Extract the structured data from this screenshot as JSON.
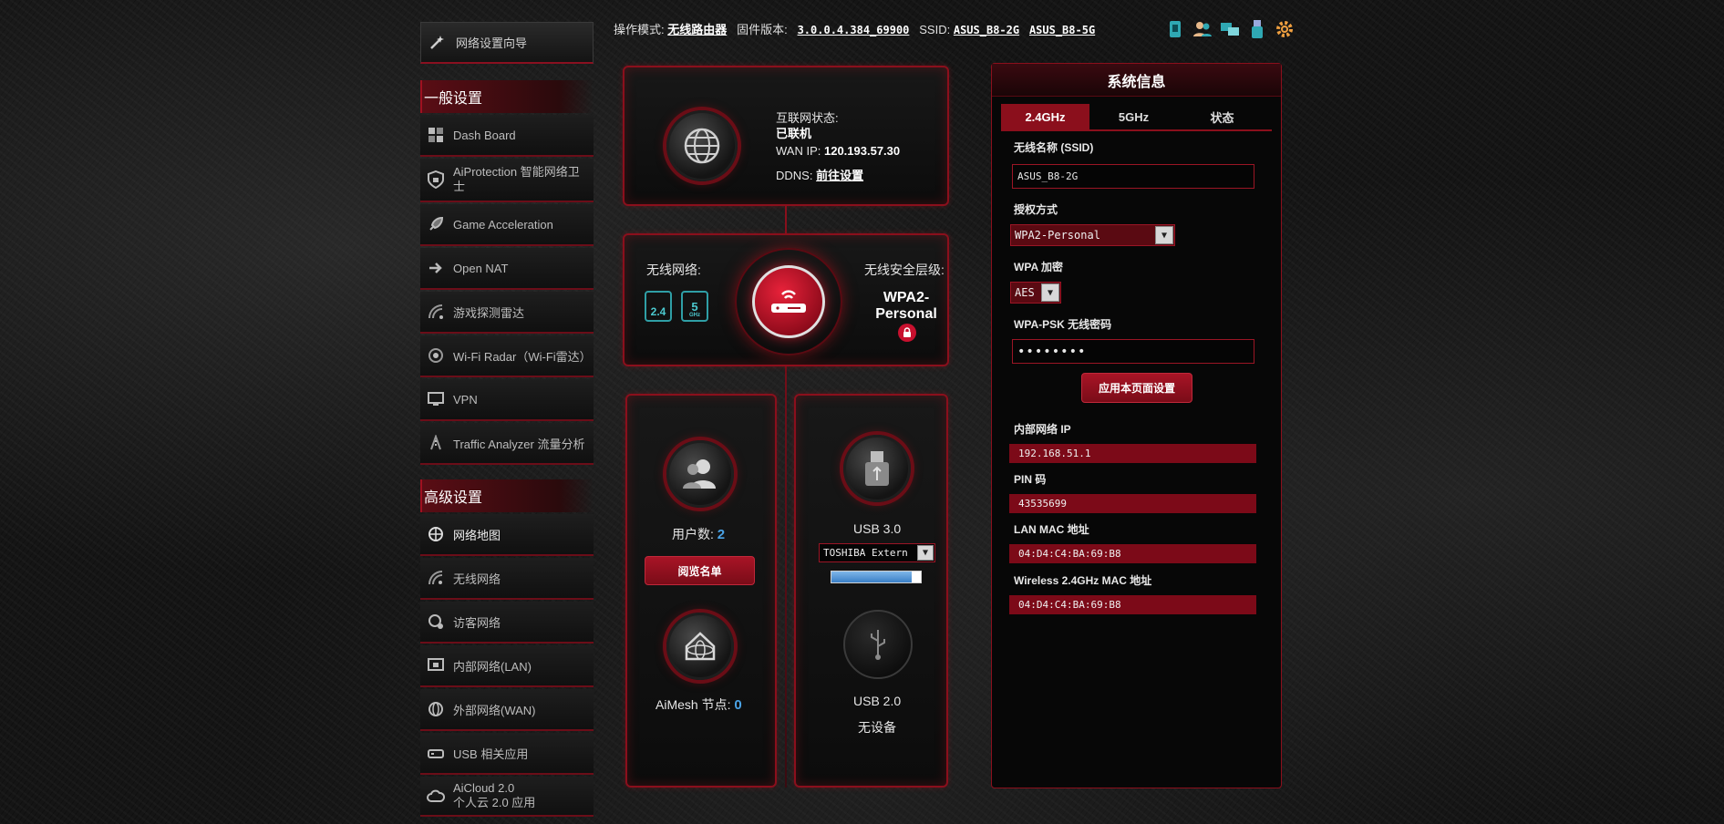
{
  "topbar": {
    "mode_label": "操作模式:",
    "mode_value": "无线路由器",
    "firmware_label": "固件版本:",
    "firmware_value": "3.0.0.4.384_69900",
    "ssid_label": "SSID:",
    "ssid_24": "ASUS_B8-2G",
    "ssid_5": "ASUS_B8-5G"
  },
  "sidebar": {
    "wizard_label": "网络设置向导",
    "general_header": "一般设置",
    "general_items": [
      {
        "label": "Dash Board",
        "icon": "dashboard-icon"
      },
      {
        "label": "AiProtection 智能网络卫士",
        "icon": "shield-icon"
      },
      {
        "label": "Game Acceleration",
        "icon": "rocket-icon"
      },
      {
        "label": "Open NAT",
        "icon": "arrow-icon"
      },
      {
        "label": "游戏探测雷达",
        "icon": "radar-icon"
      },
      {
        "label": "Wi-Fi Radar（Wi-Fi雷达）",
        "icon": "wifi-radar-icon"
      },
      {
        "label": "VPN",
        "icon": "vpn-icon"
      },
      {
        "label": "Traffic Analyzer 流量分析",
        "icon": "traffic-icon"
      }
    ],
    "advanced_header": "高级设置",
    "advanced_items": [
      {
        "label": "网络地图",
        "icon": "network-map-icon"
      },
      {
        "label": "无线网络",
        "icon": "wireless-icon"
      },
      {
        "label": "访客网络",
        "icon": "guest-network-icon"
      },
      {
        "label": "内部网络(LAN)",
        "icon": "lan-icon"
      },
      {
        "label": "外部网络(WAN)",
        "icon": "wan-icon"
      },
      {
        "label": "USB 相关应用",
        "icon": "usb-app-icon"
      },
      {
        "label": "AiCloud 2.0",
        "label2": "个人云 2.0 应用",
        "icon": "cloud-icon"
      }
    ]
  },
  "internet": {
    "status_label": "互联网状态:",
    "status_value": "已联机",
    "wan_ip_label": "WAN IP:",
    "wan_ip_value": "120.193.57.30",
    "ddns_label": "DDNS:",
    "ddns_link": "前往设置"
  },
  "router": {
    "wireless_label": "无线网络:",
    "badge_24": "2.4",
    "badge_5": "5",
    "badge_5_sub": "GHz",
    "security_label": "无线安全层级:",
    "security_value_line1": "WPA2-",
    "security_value_line2": "Personal"
  },
  "clients": {
    "count_label": "用户数:",
    "count_value": "2",
    "list_button": "阅览名单",
    "aimesh_label": "AiMesh 节点:",
    "aimesh_value": "0"
  },
  "usb": {
    "usb3_label": "USB 3.0",
    "usb3_device": "TOSHIBA Extern",
    "usb3_usage": 0.9,
    "usb2_label": "USB 2.0",
    "usb2_status": "无设备"
  },
  "sysinfo": {
    "title": "系统信息",
    "tabs": [
      "2.4GHz",
      "5GHz",
      "状态"
    ],
    "ssid_label": "无线名称 (SSID)",
    "ssid_value": "ASUS_B8-2G",
    "auth_label": "授权方式",
    "auth_value": "WPA2-Personal",
    "enc_label": "WPA 加密",
    "enc_value": "AES",
    "psk_label": "WPA-PSK 无线密码",
    "psk_value": "••••••••",
    "apply_button": "应用本页面设置",
    "lan_ip_label": "内部网络 IP",
    "lan_ip_value": "192.168.51.1",
    "pin_label": "PIN 码",
    "pin_value": "43535699",
    "lan_mac_label": "LAN MAC 地址",
    "lan_mac_value": "04:D4:C4:BA:69:B8",
    "wl_mac_label": "Wireless 2.4GHz MAC 地址",
    "wl_mac_value": "04:D4:C4:BA:69:B8"
  },
  "colors": {
    "accent": "#8b0f1c",
    "wifi_badge": "#2f9fa6",
    "count_blue": "#4aa3e6"
  }
}
